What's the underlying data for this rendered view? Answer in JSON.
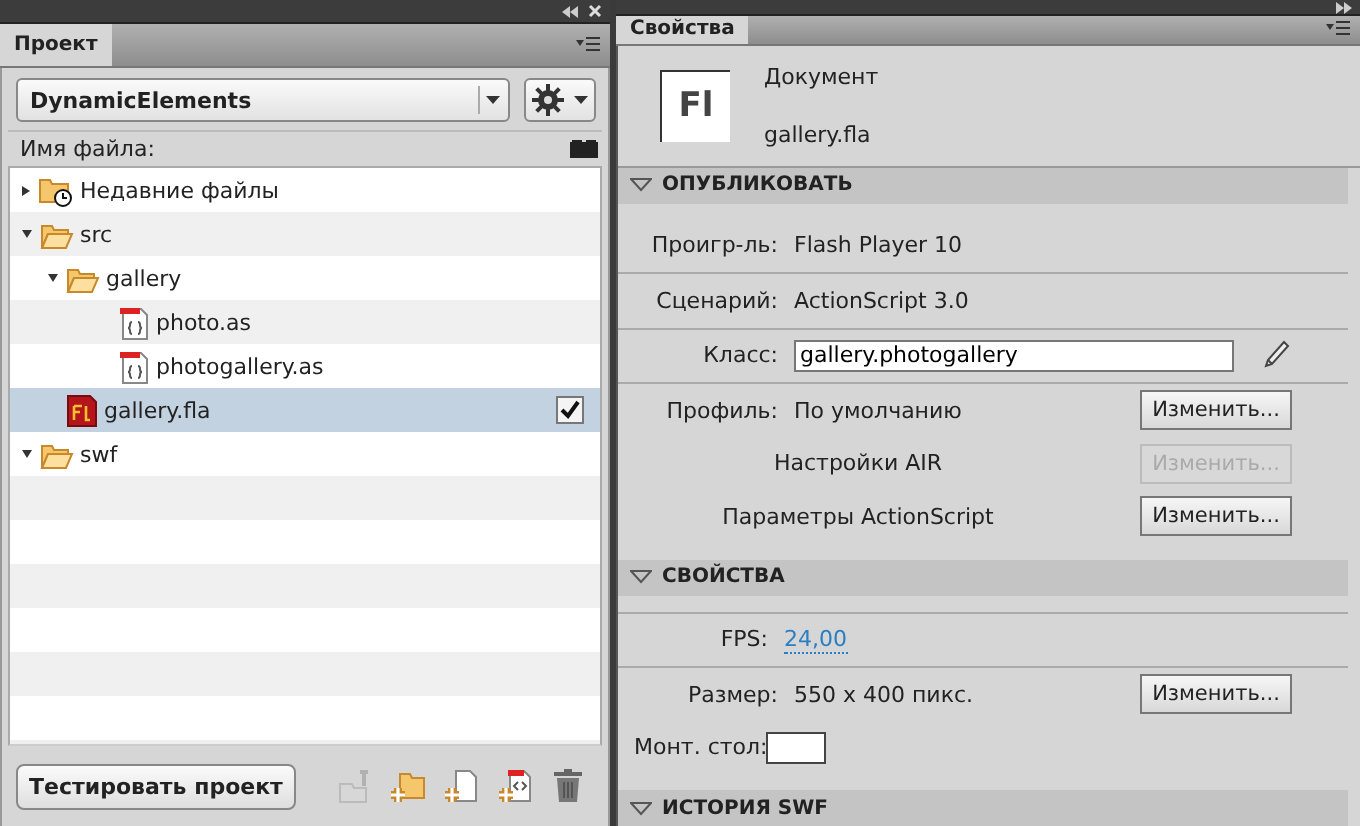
{
  "project_panel": {
    "tab": {
      "label": "Проект",
      "selected": true
    },
    "project_select": {
      "value": "DynamicElements"
    },
    "column_header": "Имя файла:",
    "tree": [
      {
        "kind": "recent",
        "name": "Недавние файлы",
        "expanded": false,
        "selected": false,
        "checked": false
      },
      {
        "kind": "folder",
        "name": "src",
        "expanded": true,
        "selected": false,
        "checked": false,
        "children": [
          {
            "kind": "folder",
            "name": "gallery",
            "expanded": true,
            "selected": false,
            "checked": false,
            "children": [
              {
                "kind": "as",
                "name": "photo.as",
                "selected": false,
                "checked": false
              },
              {
                "kind": "as",
                "name": "photogallery.as",
                "selected": false,
                "checked": false
              }
            ]
          },
          {
            "kind": "fla",
            "name": "gallery.fla",
            "selected": true,
            "checked": true
          }
        ]
      },
      {
        "kind": "folder",
        "name": "swf",
        "expanded": true,
        "selected": false,
        "checked": false
      }
    ],
    "test_button": "Тестировать проект",
    "toolbar": [
      {
        "kind": "pin",
        "disabled": true
      },
      {
        "kind": "new-folder",
        "disabled": false
      },
      {
        "kind": "new-file",
        "disabled": false
      },
      {
        "kind": "new-class",
        "disabled": false
      },
      {
        "kind": "delete",
        "disabled": false
      }
    ]
  },
  "properties_panel": {
    "tab": {
      "label": "Свойства",
      "selected": true
    },
    "document": {
      "type": "Документ",
      "file": "gallery.fla",
      "icon": "Fl"
    },
    "sections": [
      {
        "title": "ОПУБЛИКОВАТЬ",
        "expanded": true,
        "rows": [
          {
            "kind": "text",
            "label": "Проигр-ль:",
            "value": "Flash Player 10"
          },
          {
            "kind": "text",
            "label": "Сценарий:",
            "value": "ActionScript 3.0",
            "divider": true
          },
          {
            "kind": "field",
            "label": "Класс:",
            "value": "gallery.photogallery",
            "divider": true
          },
          {
            "kind": "button",
            "label": "Профиль:",
            "value": "По умолчанию",
            "button": "Изменить...",
            "disabled": false,
            "divider": true
          },
          {
            "kind": "button",
            "label": "Настройки AIR",
            "button": "Изменить...",
            "disabled": true
          },
          {
            "kind": "button",
            "label": "Параметры ActionScript",
            "button": "Изменить...",
            "disabled": false
          }
        ]
      },
      {
        "title": "СВОЙСТВА",
        "expanded": true,
        "rows": [
          {
            "kind": "link",
            "label": "FPS:",
            "value": "24,00",
            "divider": true
          },
          {
            "kind": "button",
            "label": "Размер:",
            "value": "550 x 400 пикс.",
            "button": "Изменить...",
            "disabled": false,
            "divider": true
          },
          {
            "kind": "swatch",
            "label": "Монт. стол:",
            "color": "#ffffff"
          }
        ]
      },
      {
        "title": "ИСТОРИЯ SWF",
        "expanded": true
      }
    ]
  }
}
